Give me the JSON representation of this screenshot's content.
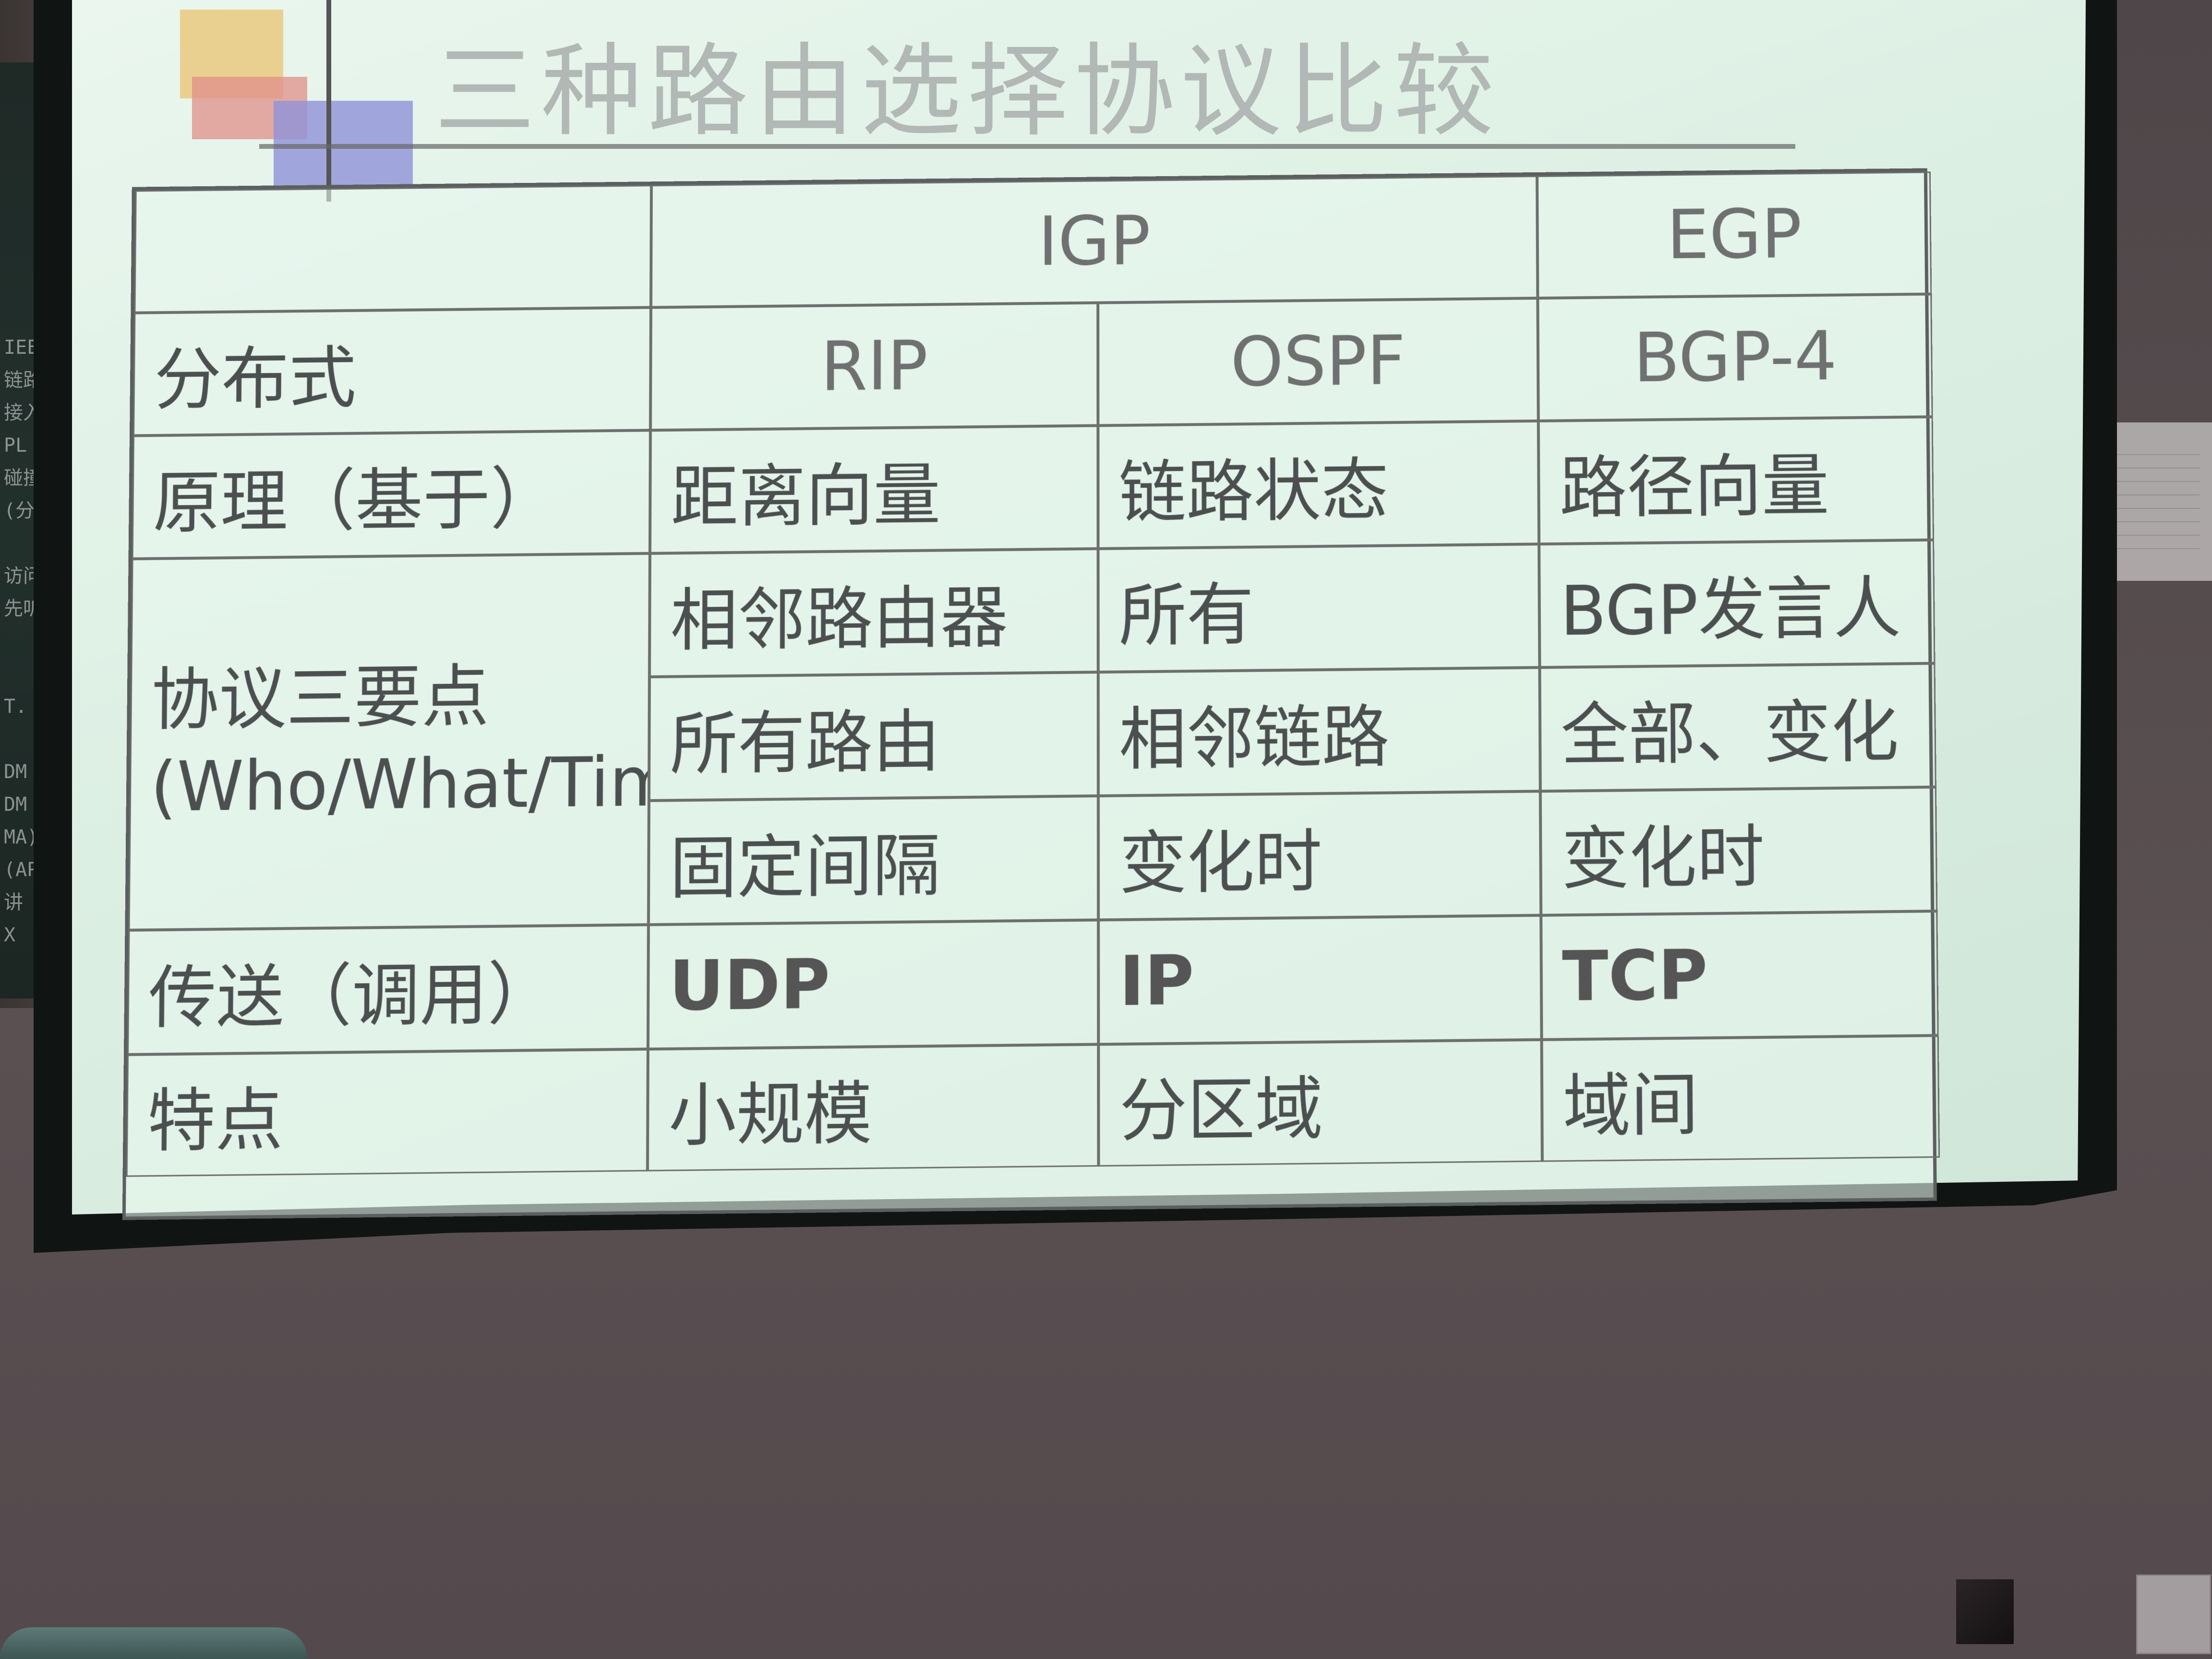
{
  "slide": {
    "title": "三种路由选择协议比较"
  },
  "table": {
    "header_igp": "IGP",
    "header_egp": "EGP",
    "row_distributed": {
      "label": "分布式",
      "rip": "RIP",
      "ospf": "OSPF",
      "bgp": "BGP-4"
    },
    "row_principle": {
      "label": "原理（基于）",
      "rip": "距离向量",
      "ospf": "链路状态",
      "bgp": "路径向量"
    },
    "row_elements": {
      "label": "协议三要点 (Who/What/Time)",
      "who": {
        "rip": "相邻路由器",
        "ospf": "所有",
        "bgp": "BGP发言人"
      },
      "what": {
        "rip": "所有路由",
        "ospf": "相邻链路",
        "bgp": "全部、变化"
      },
      "time": {
        "rip": "固定间隔",
        "ospf": "变化时",
        "bgp": "变化时"
      }
    },
    "row_transport": {
      "label": "传送（调用）",
      "rip": "UDP",
      "ospf": "IP",
      "bgp": "TCP"
    },
    "row_features": {
      "label": "特点",
      "rip": "小规模",
      "ospf": "分区域",
      "bgp": "域间"
    }
  },
  "colors": {
    "screen": "#dcefe3",
    "text": "#4c4f4f",
    "grid_line": "#6c6f6e",
    "title": "#b2b8b5"
  }
}
